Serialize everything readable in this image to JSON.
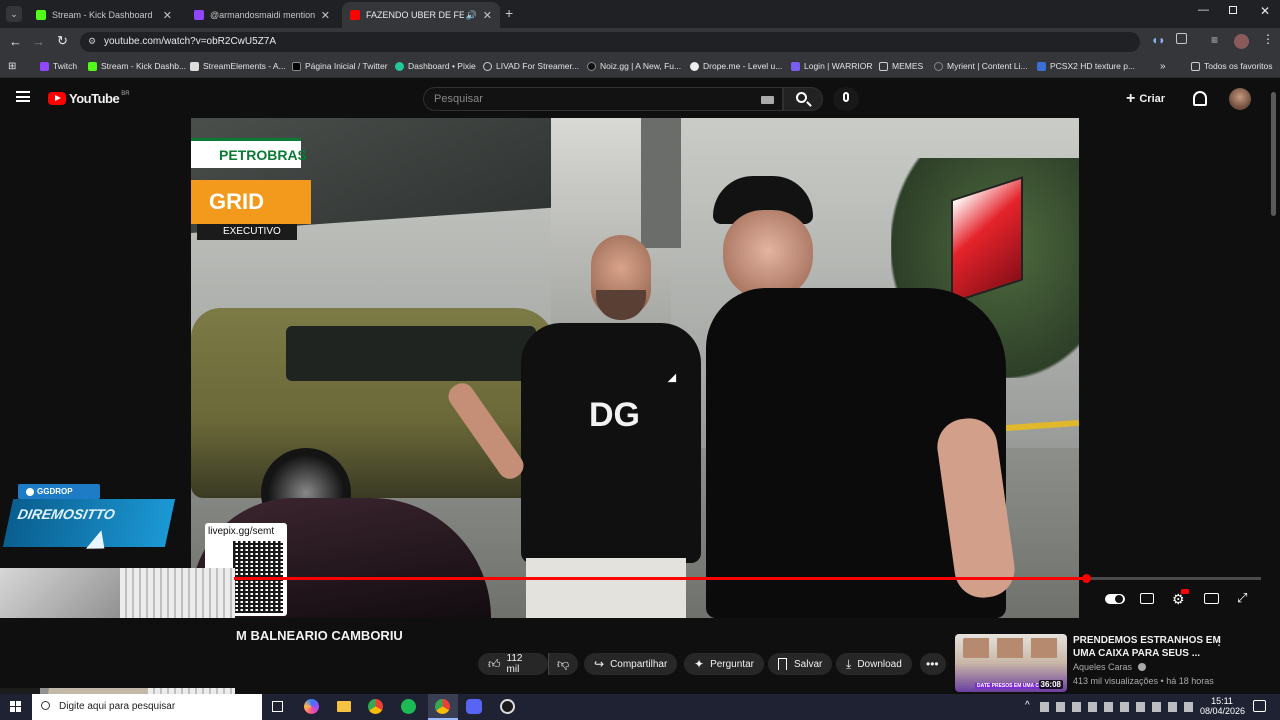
{
  "browser": {
    "tabs": [
      {
        "title": "Stream - Kick Dashboard",
        "color": "#53fc18"
      },
      {
        "title": "@armandosmaidi mentione",
        "color": "#9146ff"
      },
      {
        "title": "FAZENDO UBER DE FERRAR",
        "color": "#ff0000"
      }
    ],
    "url": "youtube.com/watch?v=obR2CwU5Z7A",
    "bookmarks": [
      "Twitch",
      "Stream - Kick Dashb...",
      "StreamElements - A...",
      "Página Inicial / Twitter",
      "Dashboard • Pixie",
      "LIVAD For Streamer...",
      "Noiz.gg | A New, Fu...",
      "Drope.me - Level u...",
      "Login | WARRIOR",
      "MEMES",
      "Myrient | Content Li...",
      "PCSX2 HD texture p..."
    ],
    "all_bookmarks": "Todos os favoritos"
  },
  "youtube": {
    "logo": "YouTube",
    "region": "BR",
    "search_placeholder": "Pesquisar",
    "create_label": "Criar",
    "video_title": "M BALNEARIO CAMBORIU",
    "actions": {
      "likes": "112 mil",
      "share": "Compartilhar",
      "ask": "Perguntar",
      "save": "Salvar",
      "download": "Download"
    },
    "recommended": {
      "title": "PRENDEMOS ESTRANHOS EM UMA CAIXA PARA SEUS ...",
      "channel": "Aqueles Caras",
      "meta": "413 mil visualizações • há 18 horas",
      "duration": "36:08",
      "thumb_caption": "DATE PRESOS EM UMA CAIXA"
    },
    "progress": 0.83
  },
  "video_scene": {
    "sign_brand": "PETROBRAS",
    "sign_grid": "GRID",
    "sign_exec": "EXECUTIVO",
    "shirt_logo": "DG"
  },
  "overlays": {
    "ggdrop": "GGDROP",
    "ggdrop_sub": "DIREMOSITTO",
    "livepix": "livepix.gg/semt"
  },
  "taskbar": {
    "search_placeholder": "Digite aqui para pesquisar",
    "time": "15:11",
    "date": "08/04/2026"
  }
}
